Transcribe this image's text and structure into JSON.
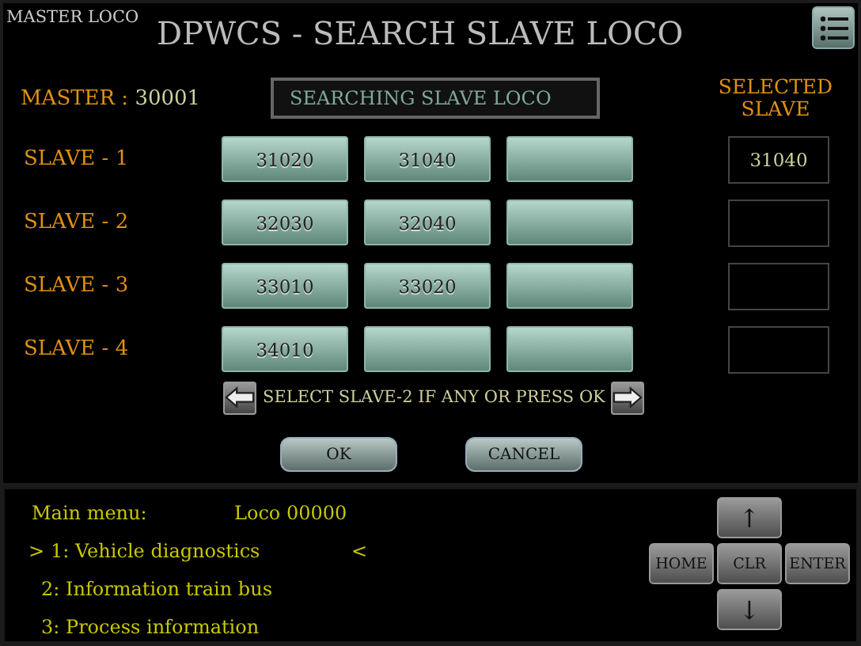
{
  "header": {
    "mode": "MASTER LOCO",
    "title": "DPWCS - SEARCH SLAVE LOCO"
  },
  "master": {
    "label": "MASTER :",
    "value": "30001"
  },
  "status": {
    "value": "SEARCHING SLAVE LOCO"
  },
  "selected_header": "SELECTED SLAVE",
  "slaves": [
    {
      "label": "SLAVE - 1",
      "candidates": [
        {
          "kind": "loco",
          "label": "31020"
        },
        {
          "kind": "loco",
          "label": "31040"
        },
        {
          "kind": "empty"
        }
      ],
      "selected": "31040"
    },
    {
      "label": "SLAVE - 2",
      "candidates": [
        {
          "kind": "loco",
          "label": "32030"
        },
        {
          "kind": "loco",
          "label": "32040"
        },
        {
          "kind": "empty"
        }
      ]
    },
    {
      "label": "SLAVE - 3",
      "candidates": [
        {
          "kind": "loco",
          "label": "33010"
        },
        {
          "kind": "loco",
          "label": "33020"
        },
        {
          "kind": "empty"
        }
      ]
    },
    {
      "label": "SLAVE - 4",
      "candidates": [
        {
          "kind": "loco",
          "label": "34010"
        },
        {
          "kind": "empty"
        },
        {
          "kind": "empty"
        }
      ]
    }
  ],
  "hint": "SELECT SLAVE-2 IF ANY OR PRESS OK",
  "buttons": [
    "OK",
    "CANCEL"
  ],
  "menu": {
    "title": "Main menu:",
    "loco": "Loco 00000",
    "items": [
      {
        "cursor_left": ">",
        "label": "1: Vehicle diagnostics",
        "cursor_right": "<"
      },
      {
        "label": "2: Information train bus"
      },
      {
        "label": "3: Process information"
      }
    ]
  },
  "keypad": {
    "up": "↑",
    "home": "HOME",
    "clear": "CLR",
    "enter": "ENTER",
    "down": "↓"
  }
}
